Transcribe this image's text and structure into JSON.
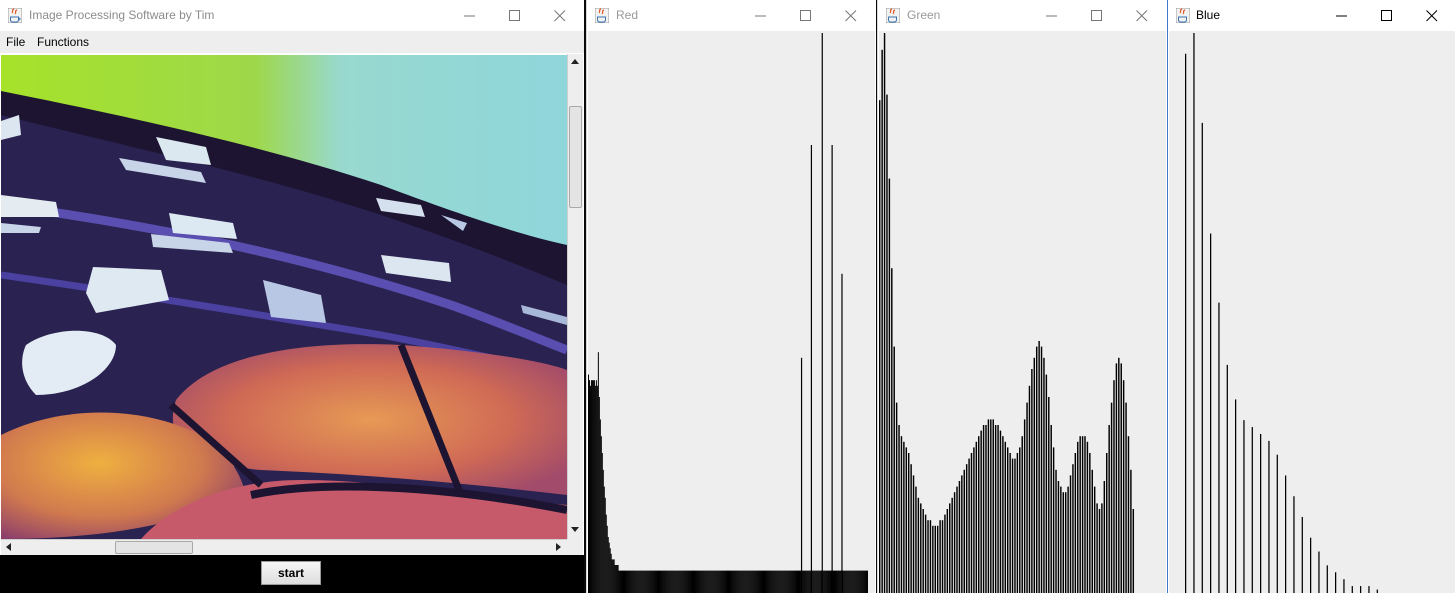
{
  "main_window": {
    "title": "Image Processing Software by Tim",
    "menu": [
      "File",
      "Functions"
    ],
    "start_label": "start"
  },
  "histograms": [
    {
      "title": "Red",
      "color": "#000000",
      "active": false,
      "chart_data": {
        "type": "bar",
        "x": [
          0,
          1,
          2,
          3,
          4,
          5,
          6,
          7,
          8,
          9,
          10,
          11,
          12,
          13,
          14,
          15,
          16,
          17,
          18,
          19,
          20,
          21,
          22,
          23,
          24,
          25,
          26,
          27,
          28,
          29,
          30,
          31,
          32,
          33,
          34,
          35,
          36,
          37,
          38,
          39,
          40,
          41,
          42,
          43,
          44,
          45,
          46,
          47,
          48,
          49,
          50,
          51,
          52,
          53,
          54,
          55,
          56,
          57,
          58,
          59,
          60,
          61,
          62,
          63,
          64,
          65,
          66,
          67,
          68,
          69,
          70,
          71,
          72,
          73,
          74,
          75,
          76,
          77,
          78,
          79,
          80,
          81,
          82,
          83,
          84,
          85,
          86,
          87,
          88,
          89,
          90,
          91,
          92,
          93,
          94,
          95,
          96,
          97,
          98,
          99,
          100,
          101,
          102,
          103,
          104,
          105,
          106,
          107,
          108,
          109,
          110,
          111,
          112,
          113,
          114,
          115,
          116,
          117,
          118,
          119,
          120,
          121,
          122,
          123,
          124,
          125,
          126,
          127,
          128,
          129,
          130,
          131,
          132,
          133,
          134,
          135,
          136,
          137,
          138,
          139,
          140,
          141,
          142,
          143,
          144,
          145,
          146,
          147,
          148,
          149,
          150,
          151,
          152,
          153,
          154,
          155,
          156,
          157,
          158,
          159,
          160,
          161,
          162,
          163,
          164,
          165,
          166,
          167,
          168,
          169,
          170,
          171,
          172,
          173,
          174,
          175,
          176,
          177,
          178,
          179,
          180,
          181,
          182,
          183,
          184,
          185,
          186,
          187,
          188,
          189,
          190,
          191,
          192,
          193,
          194,
          195,
          196,
          197,
          198,
          199,
          200,
          201,
          202,
          203,
          204,
          205,
          206,
          207,
          208,
          209,
          210,
          211,
          212,
          213,
          214,
          215,
          216,
          217,
          218,
          219,
          220,
          221,
          222,
          223,
          224,
          225,
          226,
          227,
          228,
          229,
          230,
          231,
          232,
          233,
          234,
          235,
          236,
          237,
          238,
          239,
          240,
          241,
          242,
          243,
          244,
          245,
          246,
          247,
          248,
          249,
          250,
          251,
          252,
          253,
          254,
          255,
          256,
          257,
          258,
          259,
          260,
          261,
          262,
          263,
          264,
          265,
          266,
          267,
          268,
          269,
          270,
          271,
          272,
          273,
          274,
          275,
          276,
          277,
          278,
          279,
          280,
          281,
          282,
          283,
          284,
          285,
          286,
          287
        ],
        "values": [
          0.39,
          0.38,
          0.37,
          0.38,
          0.38,
          0.38,
          0.38,
          0.37,
          0.38,
          0.37,
          0.43,
          0.35,
          0.31,
          0.28,
          0.25,
          0.22,
          0.19,
          0.17,
          0.14,
          0.12,
          0.1,
          0.09,
          0.08,
          0.07,
          0.06,
          0.06,
          0.06,
          0.05,
          0.05,
          0.05,
          0.05,
          0.04,
          0.04,
          0.04,
          0.04,
          0.04,
          0.04,
          0.04,
          0.04,
          0.04,
          0.04,
          0.04,
          0.04,
          0.04,
          0.04,
          0.04,
          0.04,
          0.04,
          0.04,
          0.04,
          0.04,
          0.04,
          0.04,
          0.04,
          0.04,
          0.04,
          0.04,
          0.04,
          0.04,
          0.04,
          0.04,
          0.04,
          0.04,
          0.04,
          0.04,
          0.04,
          0.04,
          0.04,
          0.04,
          0.04,
          0.04,
          0.04,
          0.04,
          0.04,
          0.04,
          0.04,
          0.04,
          0.04,
          0.04,
          0.04,
          0.04,
          0.04,
          0.04,
          0.04,
          0.04,
          0.04,
          0.04,
          0.04,
          0.04,
          0.04,
          0.04,
          0.04,
          0.04,
          0.04,
          0.04,
          0.04,
          0.04,
          0.04,
          0.04,
          0.04,
          0.04,
          0.04,
          0.04,
          0.04,
          0.04,
          0.04,
          0.04,
          0.04,
          0.04,
          0.04,
          0.04,
          0.04,
          0.04,
          0.04,
          0.04,
          0.04,
          0.04,
          0.04,
          0.04,
          0.04,
          0.04,
          0.04,
          0.04,
          0.04,
          0.04,
          0.04,
          0.04,
          0.04,
          0.04,
          0.04,
          0.04,
          0.04,
          0.04,
          0.04,
          0.04,
          0.04,
          0.04,
          0.04,
          0.04,
          0.04,
          0.04,
          0.04,
          0.04,
          0.04,
          0.04,
          0.04,
          0.04,
          0.04,
          0.04,
          0.04,
          0.04,
          0.04,
          0.04,
          0.04,
          0.04,
          0.04,
          0.04,
          0.04,
          0.04,
          0.04,
          0.04,
          0.04,
          0.04,
          0.04,
          0.04,
          0.04,
          0.04,
          0.04,
          0.04,
          0.04,
          0.04,
          0.04,
          0.04,
          0.04,
          0.04,
          0.04,
          0.04,
          0.04,
          0.04,
          0.04,
          0.04,
          0.04,
          0.04,
          0.04,
          0.04,
          0.04,
          0.04,
          0.04,
          0.04,
          0.04,
          0.04,
          0.04,
          0.04,
          0.04,
          0.04,
          0.04,
          0.04,
          0.04,
          0.04,
          0.04,
          0.04,
          0.04,
          0.04,
          0.04,
          0.04,
          0.04,
          0.04,
          0.04,
          0.04,
          0.04,
          0.04,
          0.04,
          0.04,
          0.04,
          0.04,
          0.04,
          0.04,
          0.04,
          0.04,
          0.04,
          0.04,
          0.04,
          0.04,
          0.04,
          0.04,
          0.04,
          0.04,
          0.04,
          0.04,
          0.04,
          0.04,
          0.04,
          0.04,
          0.04,
          0.04,
          0.04,
          0.04,
          0.04,
          0.04,
          0.04,
          0.04,
          0.04,
          0.04,
          0.04,
          0.04,
          0.04,
          0.04,
          0.04,
          0.04,
          0.04,
          0.04,
          0.04,
          0.04,
          0.04,
          0.04,
          0.04,
          0.04,
          0.04,
          0.04,
          0.04,
          0.04,
          0.04,
          0.04,
          0.04,
          0.04,
          0.04,
          0.04,
          0.04,
          0.04,
          0.04,
          0.04,
          0.04,
          0.04,
          0.04,
          0.04,
          0.04,
          0.04,
          0.04,
          0.04,
          0.04,
          0.04,
          0.04,
          0.04,
          0.04
        ],
        "spikes": [
          [
            216,
            0.42
          ],
          [
            226,
            0.8
          ],
          [
            237,
            1.0
          ],
          [
            247,
            0.8
          ],
          [
            257,
            0.57
          ]
        ]
      }
    },
    {
      "title": "Green",
      "color": "#000000",
      "active": false,
      "chart_data": {
        "type": "bar",
        "x": [],
        "values": [
          0.88,
          0.97,
          1.0,
          0.89,
          0.74,
          0.58,
          0.44,
          0.34,
          0.3,
          0.28,
          0.27,
          0.26,
          0.25,
          0.23,
          0.21,
          0.19,
          0.17,
          0.16,
          0.15,
          0.14,
          0.13,
          0.13,
          0.12,
          0.12,
          0.12,
          0.13,
          0.13,
          0.14,
          0.15,
          0.16,
          0.17,
          0.18,
          0.19,
          0.2,
          0.21,
          0.22,
          0.23,
          0.24,
          0.25,
          0.26,
          0.27,
          0.28,
          0.29,
          0.3,
          0.3,
          0.31,
          0.31,
          0.31,
          0.3,
          0.3,
          0.29,
          0.28,
          0.27,
          0.26,
          0.25,
          0.24,
          0.24,
          0.25,
          0.26,
          0.28,
          0.31,
          0.34,
          0.37,
          0.4,
          0.42,
          0.44,
          0.45,
          0.44,
          0.42,
          0.39,
          0.35,
          0.3,
          0.26,
          0.22,
          0.2,
          0.19,
          0.18,
          0.18,
          0.19,
          0.21,
          0.23,
          0.25,
          0.27,
          0.28,
          0.28,
          0.28,
          0.27,
          0.25,
          0.22,
          0.19,
          0.16,
          0.15,
          0.16,
          0.2,
          0.25,
          0.3,
          0.34,
          0.38,
          0.41,
          0.42,
          0.41,
          0.38,
          0.34,
          0.28,
          0.22,
          0.15
        ]
      }
    },
    {
      "title": "Blue",
      "color": "#000000",
      "active": true,
      "chart_data": {
        "type": "bar",
        "x": [],
        "values": [
          0.78,
          0.81,
          0.68,
          0.52,
          0.42,
          0.33,
          0.28,
          0.25,
          0.24,
          0.23,
          0.22,
          0.2,
          0.17,
          0.14,
          0.11,
          0.08,
          0.06,
          0.04,
          0.03,
          0.02,
          0.01,
          0.01,
          0.01,
          0.005
        ]
      }
    }
  ]
}
